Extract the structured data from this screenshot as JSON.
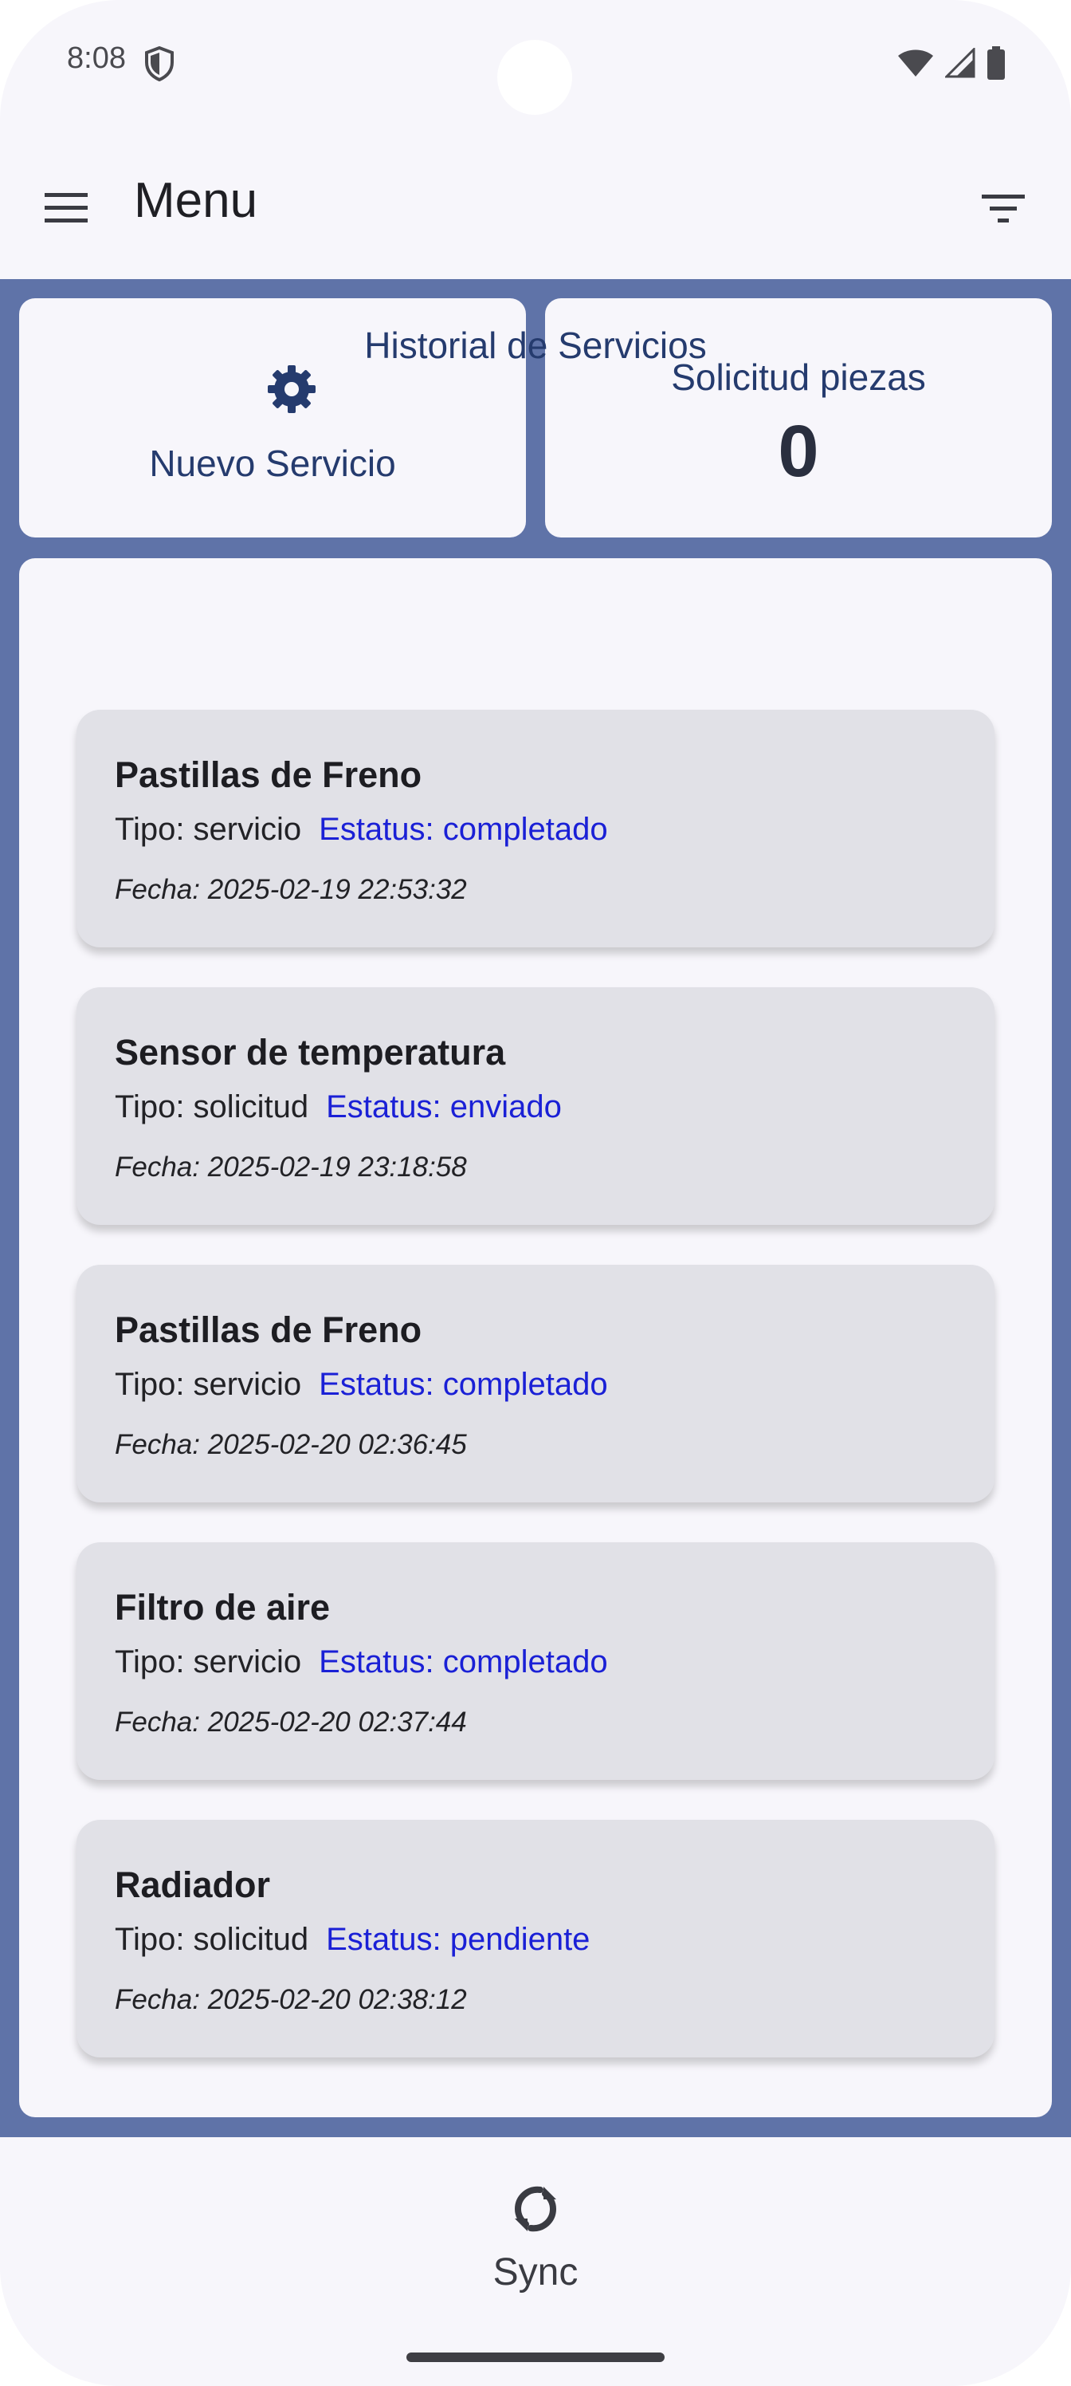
{
  "status_bar": {
    "time": "8:08",
    "icons": [
      "shield-icon",
      "wifi-icon",
      "signal-icon",
      "battery-icon"
    ]
  },
  "app_bar": {
    "title": "Menu",
    "menu_icon": "hamburger-menu-icon",
    "filter_icon": "filter-icon"
  },
  "tiles": {
    "new_service": {
      "icon": "gear-icon",
      "label": "Nuevo Servicio"
    },
    "parts_request": {
      "label": "Solicitud piezas",
      "count": "0"
    }
  },
  "history": {
    "title": "Historial de Servicios",
    "items": [
      {
        "title": "Pastillas de Freno",
        "type": "Tipo: servicio",
        "status": "Estatus: completado",
        "date": "Fecha: 2025-02-19 22:53:32"
      },
      {
        "title": "Sensor de temperatura",
        "type": "Tipo: solicitud",
        "status": "Estatus: enviado",
        "date": "Fecha: 2025-02-19 23:18:58"
      },
      {
        "title": "Pastillas de Freno",
        "type": "Tipo: servicio",
        "status": "Estatus: completado",
        "date": "Fecha: 2025-02-20 02:36:45"
      },
      {
        "title": "Filtro de aire",
        "type": "Tipo: servicio",
        "status": "Estatus: completado",
        "date": "Fecha: 2025-02-20 02:37:44"
      },
      {
        "title": "Radiador",
        "type": "Tipo: solicitud",
        "status": "Estatus: pendiente",
        "date": "Fecha: 2025-02-20 02:38:12"
      }
    ]
  },
  "bottom_bar": {
    "sync_icon": "sync-icon",
    "sync_label": "Sync"
  },
  "colors": {
    "background": "#f7f6fb",
    "content_frame": "#5f73a8",
    "accent_text": "#253b6e",
    "status_text": "#1a20d6",
    "card_background": "#e1e1e7"
  }
}
